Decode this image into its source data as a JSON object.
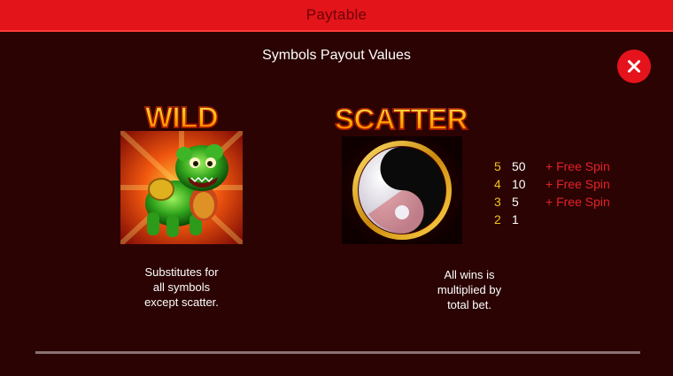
{
  "header": {
    "title": "Paytable"
  },
  "subtitle": "Symbols Payout Values",
  "close_icon": "close-icon",
  "symbols": {
    "wild": {
      "title": "WILD",
      "icon": "green-foo-dog-icon",
      "description_lines": [
        "Substitutes for",
        "all symbols",
        "except scatter."
      ]
    },
    "scatter": {
      "title": "SCATTER",
      "icon": "yin-yang-icon",
      "description_lines": [
        "All wins is",
        "multiplied by",
        "total bet."
      ],
      "payouts": [
        {
          "count": "5",
          "value": "50",
          "extra": "+ Free Spin"
        },
        {
          "count": "4",
          "value": "10",
          "extra": "+ Free Spin"
        },
        {
          "count": "3",
          "value": "5",
          "extra": "+ Free Spin"
        },
        {
          "count": "2",
          "value": "1",
          "extra": ""
        }
      ]
    }
  },
  "colors": {
    "header": "#e4141b",
    "background": "#2b0303",
    "count": "#f2c21a",
    "extra": "#e5222a"
  }
}
